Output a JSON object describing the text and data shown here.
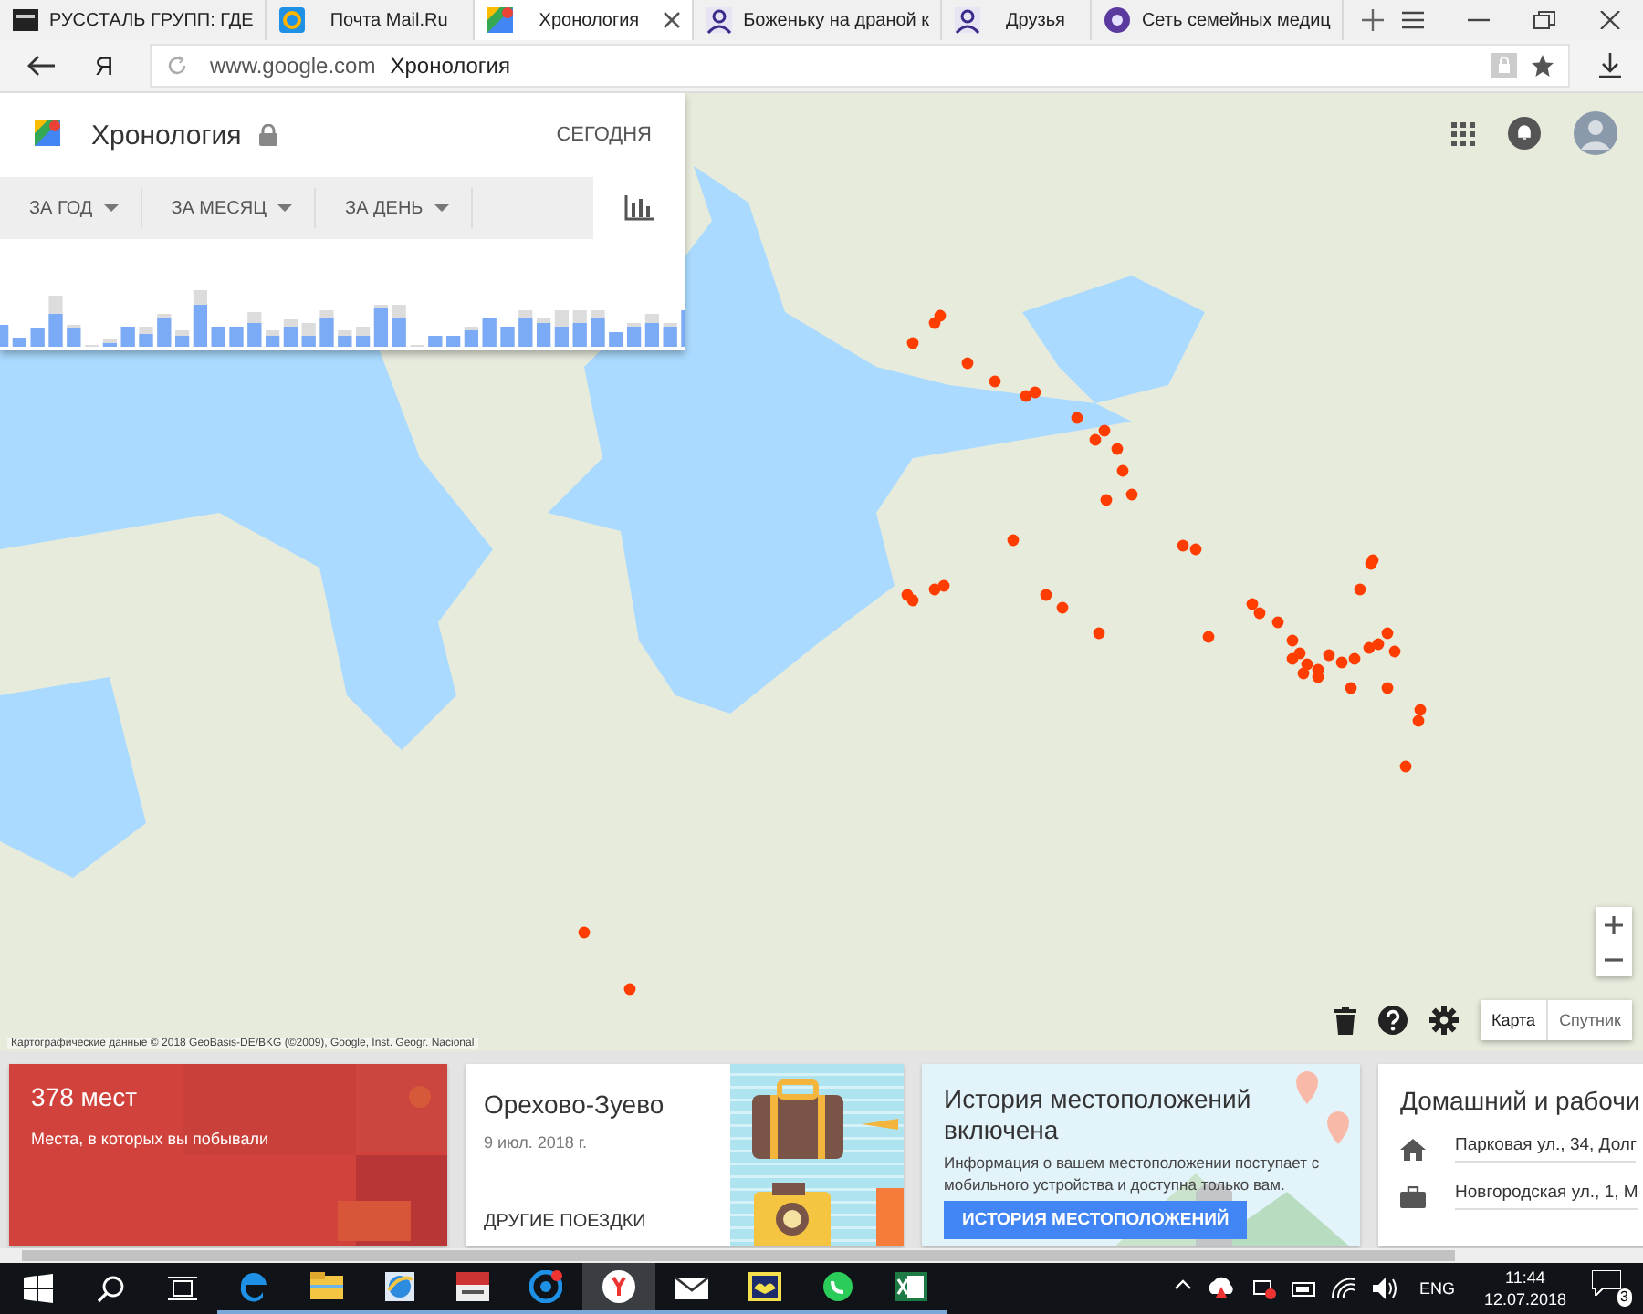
{
  "browser": {
    "tabs": [
      {
        "title": "РУССТАЛЬ ГРУПП: ГДЕ",
        "kind": "page",
        "selected": false
      },
      {
        "title": "Почта Mail.Ru",
        "kind": "mail",
        "selected": false
      },
      {
        "title": "Хронология",
        "kind": "maps",
        "selected": true
      },
      {
        "title": "Боженьку на драной к",
        "kind": "person",
        "selected": false
      },
      {
        "title": "Друзья",
        "kind": "person",
        "selected": false
      },
      {
        "title": "Сеть семейных медиц",
        "kind": "clinic",
        "selected": false
      }
    ],
    "address": {
      "domain": "www.google.com",
      "page_title": "Хронология"
    },
    "logo": "Я"
  },
  "timeline_panel": {
    "title": "Хронология",
    "today_button": "СЕГОДНЯ",
    "filters": [
      "ЗА ГОД",
      "ЗА МЕСЯЦ",
      "ЗА ДЕНЬ"
    ]
  },
  "map": {
    "attribution": "Картографические данные © 2018 GeoBasis-DE/BKG (©2009), Google, Inst. Geogr. Nacional",
    "view_buttons": [
      {
        "label": "Карта",
        "selected": true
      },
      {
        "label": "Спутник",
        "selected": false
      }
    ]
  },
  "cards": [
    {
      "kind": "stats",
      "title": "378 мест",
      "subtitle": "Места, в которых вы побывали"
    },
    {
      "kind": "trip",
      "title": "Орехово-Зуево",
      "date": "9 июл. 2018 г.",
      "link": "ДРУГИЕ ПОЕЗДКИ"
    },
    {
      "kind": "history",
      "title": "История местоположений включена",
      "text": "Информация о вашем местоположении поступает с мобильного устройства и доступна только вам.",
      "button": "ИСТОРИЯ МЕСТОПОЛОЖЕНИЙ"
    },
    {
      "kind": "places",
      "title": "Домашний и рабочи",
      "items": [
        {
          "kind": "home",
          "text": "Парковая ул., 34, Долг"
        },
        {
          "kind": "work",
          "text": "Новгородская ул., 1, М"
        }
      ]
    }
  ],
  "taskbar": {
    "language": "ENG",
    "time": "11:44",
    "date": "12.07.2018",
    "notification_count": "3"
  }
}
